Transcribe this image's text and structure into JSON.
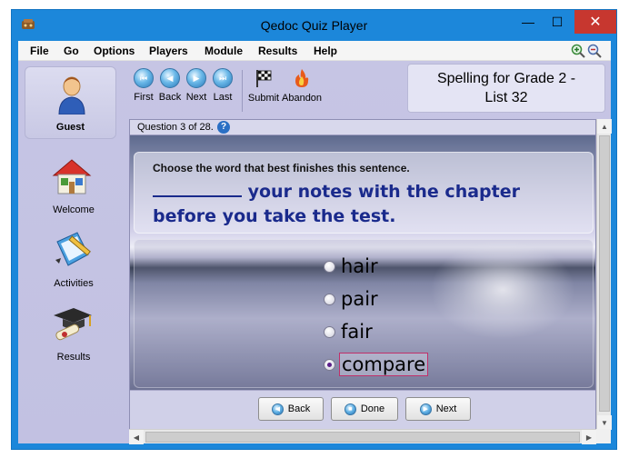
{
  "window": {
    "title": "Qedoc Quiz Player",
    "minimize_glyph": "—",
    "maximize_glyph": "☐",
    "close_glyph": "✕"
  },
  "menu": {
    "items": [
      "File",
      "Go",
      "Options",
      "Players",
      "Module",
      "Results",
      "Help"
    ]
  },
  "sidebar": {
    "user_label": "Guest",
    "items": [
      {
        "label": "Welcome",
        "icon": "home-icon"
      },
      {
        "label": "Activities",
        "icon": "notebook-pencil-icon"
      },
      {
        "label": "Results",
        "icon": "graduation-cap-icon"
      }
    ]
  },
  "toolbar": {
    "buttons": [
      {
        "label": "First",
        "icon": "first-icon",
        "glyph": "⏮"
      },
      {
        "label": "Back",
        "icon": "back-icon",
        "glyph": "◀"
      },
      {
        "label": "Next",
        "icon": "next-icon",
        "glyph": "▶"
      },
      {
        "label": "Last",
        "icon": "last-icon",
        "glyph": "⏭"
      },
      {
        "label": "Submit",
        "icon": "checkered-flag-icon"
      },
      {
        "label": "Abandon",
        "icon": "fire-icon"
      }
    ]
  },
  "module_title": {
    "line1": "Spelling for Grade 2 -",
    "line2": "List 32"
  },
  "question": {
    "counter": "Question 3 of 28.",
    "help_glyph": "?",
    "instruction": "Choose the word that best finishes this sentence.",
    "sentence_part1": " your notes with the chapter",
    "sentence_part2": "before you take the test.",
    "answers": [
      {
        "text": "hair",
        "selected": false
      },
      {
        "text": "pair",
        "selected": false
      },
      {
        "text": "fair",
        "selected": false
      },
      {
        "text": "compare",
        "selected": true
      }
    ]
  },
  "nav_buttons": {
    "back": "Back",
    "done": "Done",
    "next": "Next"
  },
  "colors": {
    "window_frame": "#1c87da",
    "sentence_text": "#1a2a8c",
    "close_button": "#c7372f",
    "selected_border": "#c0306a"
  }
}
